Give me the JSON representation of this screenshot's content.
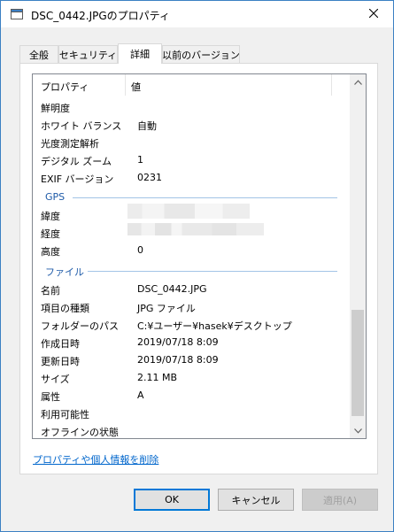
{
  "window": {
    "title": "DSC_0442.JPGのプロパティ",
    "close_icon": "close-icon",
    "title_icon": "window-icon"
  },
  "tabs": [
    {
      "label": "全般"
    },
    {
      "label": "セキュリティ"
    },
    {
      "label": "詳細",
      "active": true
    },
    {
      "label": "以前のバージョン"
    }
  ],
  "list": {
    "columns": [
      "プロパティ",
      "値"
    ],
    "rows_top": [
      {
        "key": "鮮明度",
        "value": ""
      },
      {
        "key": "ホワイト バランス",
        "value": "自動"
      },
      {
        "key": "光度測定解析",
        "value": ""
      },
      {
        "key": "デジタル ズーム",
        "value": "1"
      },
      {
        "key": "EXIF バージョン",
        "value": "0231"
      }
    ],
    "group_gps": "GPS",
    "rows_gps": [
      {
        "key": "緯度",
        "value": ""
      },
      {
        "key": "経度",
        "value": ""
      },
      {
        "key": "高度",
        "value": "0"
      }
    ],
    "group_file": "ファイル",
    "rows_file": [
      {
        "key": "名前",
        "value": "DSC_0442.JPG"
      },
      {
        "key": "項目の種類",
        "value": "JPG ファイル"
      },
      {
        "key": "フォルダーのパス",
        "value": "C:¥ユーザー¥hasek¥デスクトップ"
      },
      {
        "key": "作成日時",
        "value": "2019/07/18 8:09"
      },
      {
        "key": "更新日時",
        "value": "2019/07/18 8:09"
      },
      {
        "key": "サイズ",
        "value": "2.11 MB"
      },
      {
        "key": "属性",
        "value": "A"
      },
      {
        "key": "利用可能性",
        "value": ""
      },
      {
        "key": "オフラインの状態",
        "value": ""
      }
    ]
  },
  "link": "プロパティや個人情報を削除",
  "buttons": {
    "ok": "OK",
    "cancel": "キャンセル",
    "apply": "適用(A)"
  },
  "colors": {
    "accent": "#0078d7",
    "group_text": "#1e5aa8",
    "link": "#0066cc"
  }
}
